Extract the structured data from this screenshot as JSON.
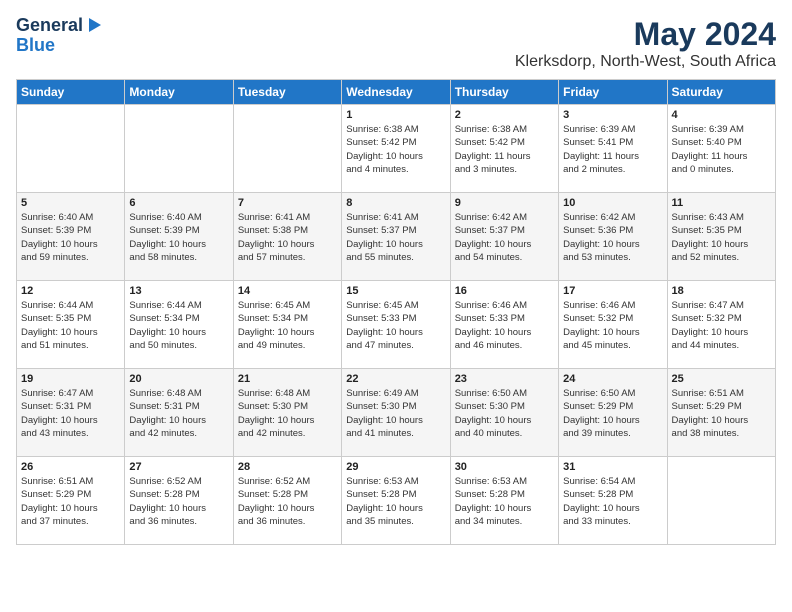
{
  "logo": {
    "general": "General",
    "blue": "Blue"
  },
  "title": "May 2024",
  "subtitle": "Klerksdorp, North-West, South Africa",
  "weekdays": [
    "Sunday",
    "Monday",
    "Tuesday",
    "Wednesday",
    "Thursday",
    "Friday",
    "Saturday"
  ],
  "weeks": [
    [
      {
        "day": "",
        "info": ""
      },
      {
        "day": "",
        "info": ""
      },
      {
        "day": "",
        "info": ""
      },
      {
        "day": "1",
        "info": "Sunrise: 6:38 AM\nSunset: 5:42 PM\nDaylight: 10 hours\nand 4 minutes."
      },
      {
        "day": "2",
        "info": "Sunrise: 6:38 AM\nSunset: 5:42 PM\nDaylight: 11 hours\nand 3 minutes."
      },
      {
        "day": "3",
        "info": "Sunrise: 6:39 AM\nSunset: 5:41 PM\nDaylight: 11 hours\nand 2 minutes."
      },
      {
        "day": "4",
        "info": "Sunrise: 6:39 AM\nSunset: 5:40 PM\nDaylight: 11 hours\nand 0 minutes."
      }
    ],
    [
      {
        "day": "5",
        "info": "Sunrise: 6:40 AM\nSunset: 5:39 PM\nDaylight: 10 hours\nand 59 minutes."
      },
      {
        "day": "6",
        "info": "Sunrise: 6:40 AM\nSunset: 5:39 PM\nDaylight: 10 hours\nand 58 minutes."
      },
      {
        "day": "7",
        "info": "Sunrise: 6:41 AM\nSunset: 5:38 PM\nDaylight: 10 hours\nand 57 minutes."
      },
      {
        "day": "8",
        "info": "Sunrise: 6:41 AM\nSunset: 5:37 PM\nDaylight: 10 hours\nand 55 minutes."
      },
      {
        "day": "9",
        "info": "Sunrise: 6:42 AM\nSunset: 5:37 PM\nDaylight: 10 hours\nand 54 minutes."
      },
      {
        "day": "10",
        "info": "Sunrise: 6:42 AM\nSunset: 5:36 PM\nDaylight: 10 hours\nand 53 minutes."
      },
      {
        "day": "11",
        "info": "Sunrise: 6:43 AM\nSunset: 5:35 PM\nDaylight: 10 hours\nand 52 minutes."
      }
    ],
    [
      {
        "day": "12",
        "info": "Sunrise: 6:44 AM\nSunset: 5:35 PM\nDaylight: 10 hours\nand 51 minutes."
      },
      {
        "day": "13",
        "info": "Sunrise: 6:44 AM\nSunset: 5:34 PM\nDaylight: 10 hours\nand 50 minutes."
      },
      {
        "day": "14",
        "info": "Sunrise: 6:45 AM\nSunset: 5:34 PM\nDaylight: 10 hours\nand 49 minutes."
      },
      {
        "day": "15",
        "info": "Sunrise: 6:45 AM\nSunset: 5:33 PM\nDaylight: 10 hours\nand 47 minutes."
      },
      {
        "day": "16",
        "info": "Sunrise: 6:46 AM\nSunset: 5:33 PM\nDaylight: 10 hours\nand 46 minutes."
      },
      {
        "day": "17",
        "info": "Sunrise: 6:46 AM\nSunset: 5:32 PM\nDaylight: 10 hours\nand 45 minutes."
      },
      {
        "day": "18",
        "info": "Sunrise: 6:47 AM\nSunset: 5:32 PM\nDaylight: 10 hours\nand 44 minutes."
      }
    ],
    [
      {
        "day": "19",
        "info": "Sunrise: 6:47 AM\nSunset: 5:31 PM\nDaylight: 10 hours\nand 43 minutes."
      },
      {
        "day": "20",
        "info": "Sunrise: 6:48 AM\nSunset: 5:31 PM\nDaylight: 10 hours\nand 42 minutes."
      },
      {
        "day": "21",
        "info": "Sunrise: 6:48 AM\nSunset: 5:30 PM\nDaylight: 10 hours\nand 42 minutes."
      },
      {
        "day": "22",
        "info": "Sunrise: 6:49 AM\nSunset: 5:30 PM\nDaylight: 10 hours\nand 41 minutes."
      },
      {
        "day": "23",
        "info": "Sunrise: 6:50 AM\nSunset: 5:30 PM\nDaylight: 10 hours\nand 40 minutes."
      },
      {
        "day": "24",
        "info": "Sunrise: 6:50 AM\nSunset: 5:29 PM\nDaylight: 10 hours\nand 39 minutes."
      },
      {
        "day": "25",
        "info": "Sunrise: 6:51 AM\nSunset: 5:29 PM\nDaylight: 10 hours\nand 38 minutes."
      }
    ],
    [
      {
        "day": "26",
        "info": "Sunrise: 6:51 AM\nSunset: 5:29 PM\nDaylight: 10 hours\nand 37 minutes."
      },
      {
        "day": "27",
        "info": "Sunrise: 6:52 AM\nSunset: 5:28 PM\nDaylight: 10 hours\nand 36 minutes."
      },
      {
        "day": "28",
        "info": "Sunrise: 6:52 AM\nSunset: 5:28 PM\nDaylight: 10 hours\nand 36 minutes."
      },
      {
        "day": "29",
        "info": "Sunrise: 6:53 AM\nSunset: 5:28 PM\nDaylight: 10 hours\nand 35 minutes."
      },
      {
        "day": "30",
        "info": "Sunrise: 6:53 AM\nSunset: 5:28 PM\nDaylight: 10 hours\nand 34 minutes."
      },
      {
        "day": "31",
        "info": "Sunrise: 6:54 AM\nSunset: 5:28 PM\nDaylight: 10 hours\nand 33 minutes."
      },
      {
        "day": "",
        "info": ""
      }
    ]
  ]
}
